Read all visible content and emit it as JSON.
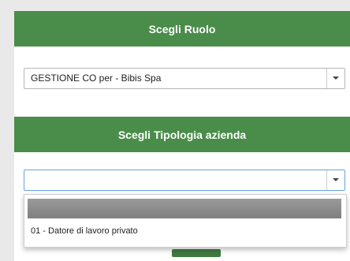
{
  "role_section": {
    "title": "Scegli Ruolo",
    "selected_value": "GESTIONE CO per - Bibis Spa"
  },
  "company_type_section": {
    "title": "Scegli Tipologia azienda",
    "selected_value": "",
    "options": [
      "",
      "01 - Datore di lavoro privato"
    ]
  },
  "colors": {
    "header_green": "#4a8c4a",
    "focus_blue": "#66a3e0"
  }
}
